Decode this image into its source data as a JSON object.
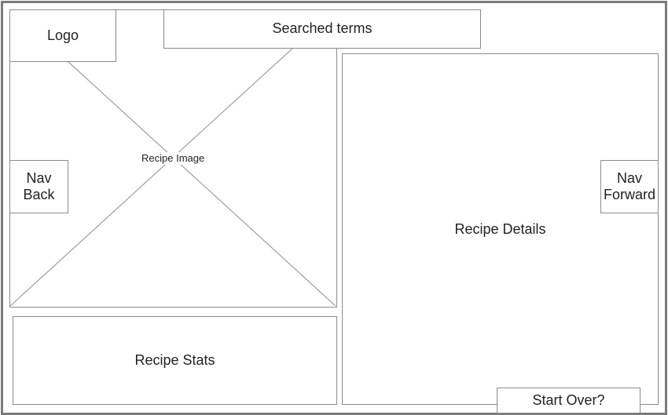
{
  "wireframe": {
    "recipe_image_label": "Recipe Image",
    "logo_label": "Logo",
    "searched_terms_label": "Searched terms",
    "nav_back_label": "Nav\nBack",
    "recipe_stats_label": "Recipe Stats",
    "recipe_details_label": "Recipe Details",
    "nav_forward_label": "Nav\nForward",
    "start_over_label": "Start Over?"
  },
  "colors": {
    "border": "#8c8c8c",
    "outer_border": "#7a7a7a",
    "text": "#222222"
  }
}
